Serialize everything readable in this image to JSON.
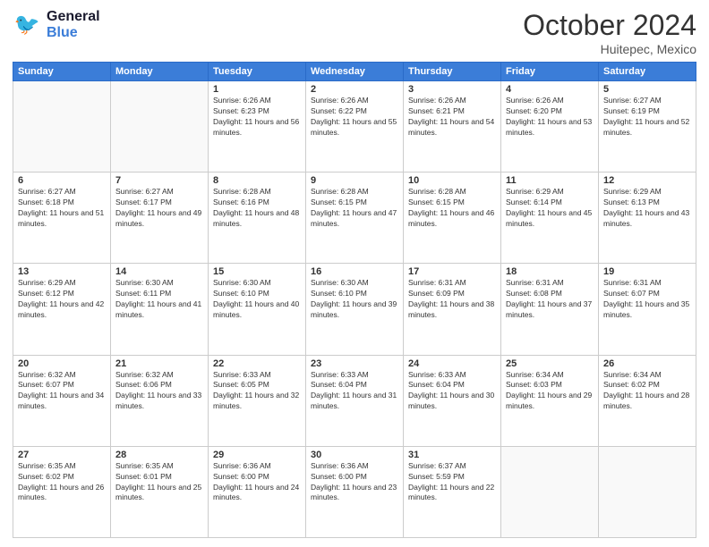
{
  "header": {
    "logo_general": "General",
    "logo_blue": "Blue",
    "month": "October 2024",
    "location": "Huitepec, Mexico"
  },
  "weekdays": [
    "Sunday",
    "Monday",
    "Tuesday",
    "Wednesday",
    "Thursday",
    "Friday",
    "Saturday"
  ],
  "weeks": [
    [
      {
        "day": "",
        "info": ""
      },
      {
        "day": "",
        "info": ""
      },
      {
        "day": "1",
        "info": "Sunrise: 6:26 AM\nSunset: 6:23 PM\nDaylight: 11 hours and 56 minutes."
      },
      {
        "day": "2",
        "info": "Sunrise: 6:26 AM\nSunset: 6:22 PM\nDaylight: 11 hours and 55 minutes."
      },
      {
        "day": "3",
        "info": "Sunrise: 6:26 AM\nSunset: 6:21 PM\nDaylight: 11 hours and 54 minutes."
      },
      {
        "day": "4",
        "info": "Sunrise: 6:26 AM\nSunset: 6:20 PM\nDaylight: 11 hours and 53 minutes."
      },
      {
        "day": "5",
        "info": "Sunrise: 6:27 AM\nSunset: 6:19 PM\nDaylight: 11 hours and 52 minutes."
      }
    ],
    [
      {
        "day": "6",
        "info": "Sunrise: 6:27 AM\nSunset: 6:18 PM\nDaylight: 11 hours and 51 minutes."
      },
      {
        "day": "7",
        "info": "Sunrise: 6:27 AM\nSunset: 6:17 PM\nDaylight: 11 hours and 49 minutes."
      },
      {
        "day": "8",
        "info": "Sunrise: 6:28 AM\nSunset: 6:16 PM\nDaylight: 11 hours and 48 minutes."
      },
      {
        "day": "9",
        "info": "Sunrise: 6:28 AM\nSunset: 6:15 PM\nDaylight: 11 hours and 47 minutes."
      },
      {
        "day": "10",
        "info": "Sunrise: 6:28 AM\nSunset: 6:15 PM\nDaylight: 11 hours and 46 minutes."
      },
      {
        "day": "11",
        "info": "Sunrise: 6:29 AM\nSunset: 6:14 PM\nDaylight: 11 hours and 45 minutes."
      },
      {
        "day": "12",
        "info": "Sunrise: 6:29 AM\nSunset: 6:13 PM\nDaylight: 11 hours and 43 minutes."
      }
    ],
    [
      {
        "day": "13",
        "info": "Sunrise: 6:29 AM\nSunset: 6:12 PM\nDaylight: 11 hours and 42 minutes."
      },
      {
        "day": "14",
        "info": "Sunrise: 6:30 AM\nSunset: 6:11 PM\nDaylight: 11 hours and 41 minutes."
      },
      {
        "day": "15",
        "info": "Sunrise: 6:30 AM\nSunset: 6:10 PM\nDaylight: 11 hours and 40 minutes."
      },
      {
        "day": "16",
        "info": "Sunrise: 6:30 AM\nSunset: 6:10 PM\nDaylight: 11 hours and 39 minutes."
      },
      {
        "day": "17",
        "info": "Sunrise: 6:31 AM\nSunset: 6:09 PM\nDaylight: 11 hours and 38 minutes."
      },
      {
        "day": "18",
        "info": "Sunrise: 6:31 AM\nSunset: 6:08 PM\nDaylight: 11 hours and 37 minutes."
      },
      {
        "day": "19",
        "info": "Sunrise: 6:31 AM\nSunset: 6:07 PM\nDaylight: 11 hours and 35 minutes."
      }
    ],
    [
      {
        "day": "20",
        "info": "Sunrise: 6:32 AM\nSunset: 6:07 PM\nDaylight: 11 hours and 34 minutes."
      },
      {
        "day": "21",
        "info": "Sunrise: 6:32 AM\nSunset: 6:06 PM\nDaylight: 11 hours and 33 minutes."
      },
      {
        "day": "22",
        "info": "Sunrise: 6:33 AM\nSunset: 6:05 PM\nDaylight: 11 hours and 32 minutes."
      },
      {
        "day": "23",
        "info": "Sunrise: 6:33 AM\nSunset: 6:04 PM\nDaylight: 11 hours and 31 minutes."
      },
      {
        "day": "24",
        "info": "Sunrise: 6:33 AM\nSunset: 6:04 PM\nDaylight: 11 hours and 30 minutes."
      },
      {
        "day": "25",
        "info": "Sunrise: 6:34 AM\nSunset: 6:03 PM\nDaylight: 11 hours and 29 minutes."
      },
      {
        "day": "26",
        "info": "Sunrise: 6:34 AM\nSunset: 6:02 PM\nDaylight: 11 hours and 28 minutes."
      }
    ],
    [
      {
        "day": "27",
        "info": "Sunrise: 6:35 AM\nSunset: 6:02 PM\nDaylight: 11 hours and 26 minutes."
      },
      {
        "day": "28",
        "info": "Sunrise: 6:35 AM\nSunset: 6:01 PM\nDaylight: 11 hours and 25 minutes."
      },
      {
        "day": "29",
        "info": "Sunrise: 6:36 AM\nSunset: 6:00 PM\nDaylight: 11 hours and 24 minutes."
      },
      {
        "day": "30",
        "info": "Sunrise: 6:36 AM\nSunset: 6:00 PM\nDaylight: 11 hours and 23 minutes."
      },
      {
        "day": "31",
        "info": "Sunrise: 6:37 AM\nSunset: 5:59 PM\nDaylight: 11 hours and 22 minutes."
      },
      {
        "day": "",
        "info": ""
      },
      {
        "day": "",
        "info": ""
      }
    ]
  ]
}
